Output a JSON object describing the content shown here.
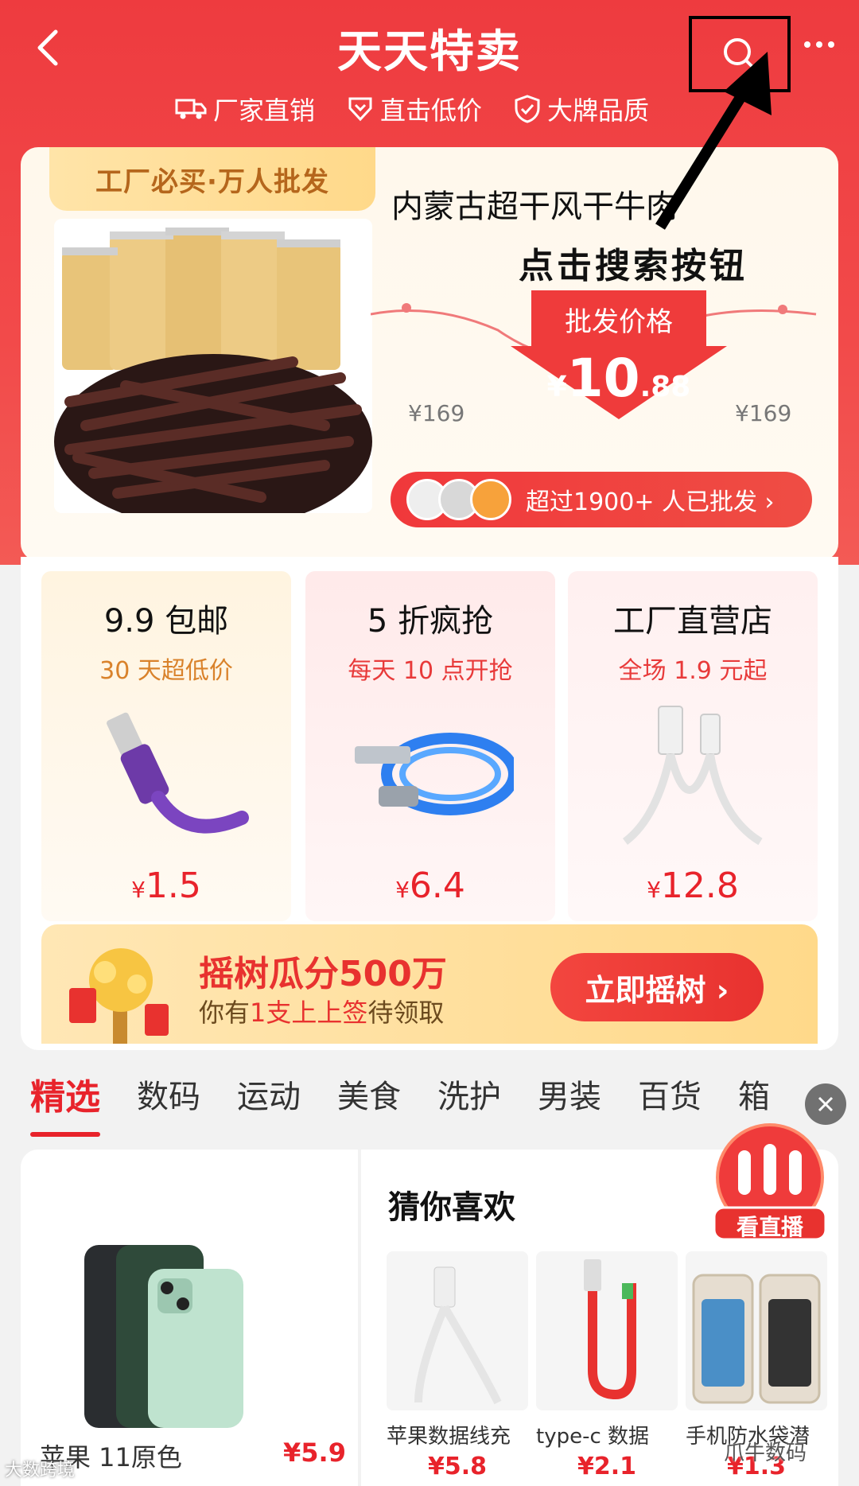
{
  "header": {
    "title": "天天特卖",
    "back_icon": "chevron-left-icon",
    "search_icon": "search-icon",
    "more_icon": "more-dots-icon"
  },
  "promises": [
    {
      "icon": "truck-icon",
      "label": "厂家直销"
    },
    {
      "icon": "price-down-icon",
      "label": "直击低价"
    },
    {
      "icon": "shield-check-icon",
      "label": "大牌品质"
    }
  ],
  "hero": {
    "tag": "工厂必买·万人批发",
    "title": "内蒙古超干风干牛肉",
    "price_label": "批发价格",
    "price_symbol": "¥",
    "price_int": "10",
    "price_dec": ".88",
    "old_price_left": "¥169",
    "old_price_right": "¥169",
    "wholesale_text": "超过1900+ 人已批发 ›"
  },
  "annotation": {
    "text": "点击搜索按钮"
  },
  "deals": [
    {
      "title": "9.9 包邮",
      "subtitle": "30 天超低价",
      "symbol": "¥",
      "price": "1.5"
    },
    {
      "title": "5 折疯抢",
      "subtitle": "每天 10 点开抢",
      "symbol": "¥",
      "price": "6.4"
    },
    {
      "title": "工厂直营店",
      "subtitle": "全场 1.9 元起",
      "symbol": "¥",
      "price": "12.8"
    }
  ],
  "shake": {
    "title": "摇树瓜分500万",
    "sub_prefix": "你有",
    "sub_highlight": "1支上上签",
    "sub_suffix": "待领取",
    "button": "立即摇树 ›"
  },
  "tabs": [
    "精选",
    "数码",
    "运动",
    "美食",
    "洗护",
    "男装",
    "百货",
    "箱"
  ],
  "guess": {
    "title": "猜你喜欢",
    "featured_name": "苹果 11原色",
    "featured_price": "¥5.9",
    "items": [
      {
        "name": "苹果数据线充",
        "price": "¥5.8"
      },
      {
        "name": "type-c 数据",
        "price": "¥2.1"
      },
      {
        "name": "手机防水袋潜",
        "price": "¥1.3"
      }
    ]
  },
  "live": {
    "label": "看直播"
  },
  "watermarks": {
    "left": "大数跨境",
    "right": "爪牛数码"
  },
  "colors": {
    "brand_red": "#ee3b3f",
    "price_red": "#e8232b",
    "gold": "#ffd98a"
  }
}
